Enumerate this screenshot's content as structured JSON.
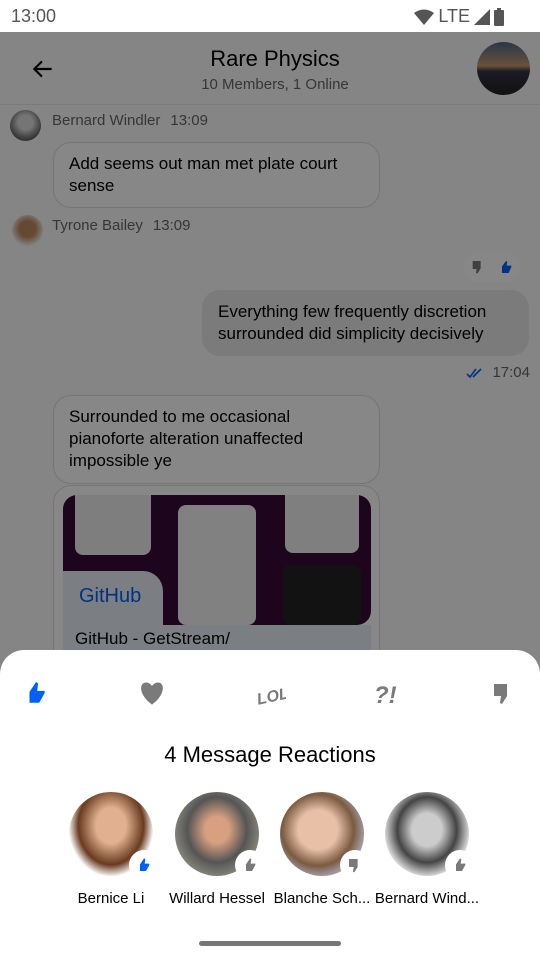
{
  "status_bar": {
    "time": "13:00",
    "network": "LTE"
  },
  "header": {
    "title": "Rare Physics",
    "subtitle": "10 Members, 1 Online"
  },
  "messages": [
    {
      "author": "Bernard Windler",
      "time": "13:09",
      "text": "Add seems out man met plate court sense"
    },
    {
      "author": "Tyrone Bailey",
      "time": "13:09"
    },
    {
      "text": "Everything few frequently discretion surrounded did simplicity decisively",
      "time": "17:04",
      "reactions": [
        "thumbs-down",
        "thumbs-up"
      ]
    },
    {
      "text": "Surrounded to me occasional pianoforte alteration unaffected impossible ye",
      "link_source": "GitHub",
      "link_title": "GitHub - GetStream/"
    }
  ],
  "sheet": {
    "reaction_types": [
      "thumbs-up",
      "heart",
      "lol",
      "wut",
      "thumbs-down"
    ],
    "selected_reaction": "thumbs-up",
    "title": "4 Message Reactions",
    "users": [
      {
        "name": "Bernice Li",
        "reaction": "thumbs-up"
      },
      {
        "name": "Willard Hessel",
        "reaction": "thumbs-up"
      },
      {
        "name": "Blanche Sch...",
        "reaction": "thumbs-down"
      },
      {
        "name": "Bernard Wind...",
        "reaction": "thumbs-up"
      }
    ]
  },
  "colors": {
    "accent": "#005fff",
    "icon_gray": "#7a7a7a"
  }
}
